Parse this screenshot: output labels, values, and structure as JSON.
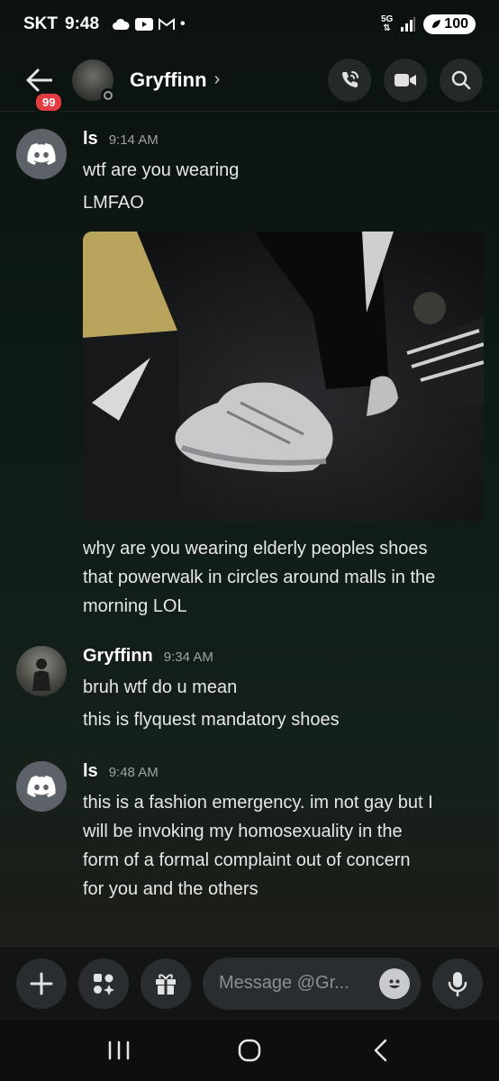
{
  "status_bar": {
    "carrier": "SKT",
    "time": "9:48",
    "network": "5G",
    "battery": "100"
  },
  "header": {
    "unread_count": "99",
    "contact_name": "Gryffinn",
    "chevron": "›"
  },
  "messages": [
    {
      "author": "ls",
      "time": "9:14 AM",
      "lines": [
        "wtf are you wearing",
        "LMFAO"
      ],
      "attachment": "image",
      "after_attachment": [
        "why are you wearing elderly peoples shoes",
        "that powerwalk in circles around malls in the",
        "morning LOL"
      ]
    },
    {
      "author": "Gryffinn",
      "time": "9:34 AM",
      "lines": [
        "bruh wtf do u mean",
        "this is flyquest mandatory shoes"
      ]
    },
    {
      "author": "ls",
      "time": "9:48 AM",
      "lines": [
        "this is a fashion emergency. im not gay but I",
        "will be invoking my homosexuality in the",
        "form of a formal complaint out of concern",
        "for you and the others"
      ]
    }
  ],
  "composer": {
    "placeholder": "Message @Gr..."
  },
  "icons": {
    "back": "arrow-left-icon",
    "call": "phone-icon",
    "video": "video-camera-icon",
    "search": "search-icon",
    "add": "plus-icon",
    "apps": "apps-sparkle-icon",
    "gift": "gift-icon",
    "emoji": "emoji-icon",
    "mic": "microphone-icon"
  }
}
